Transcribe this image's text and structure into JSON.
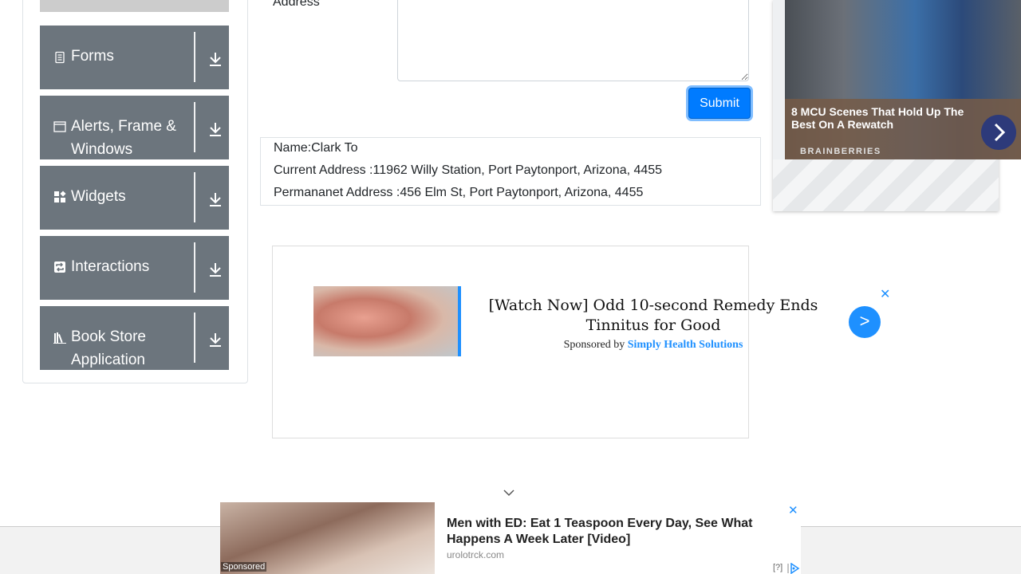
{
  "sidebar": {
    "groups": [
      {
        "label": "Forms",
        "icon": "form-icon"
      },
      {
        "label": "Alerts, Frame & Windows",
        "icon": "window-icon"
      },
      {
        "label": "Widgets",
        "icon": "widgets-icon"
      },
      {
        "label": "Interactions",
        "icon": "interactions-icon"
      },
      {
        "label": "Book Store Application",
        "icon": "books-icon"
      }
    ]
  },
  "form": {
    "address_label": "Address",
    "submit_label": "Submit"
  },
  "output": {
    "name": "Name:Clark To",
    "current_address": "Current Address :11962 Willy Station, Port Paytonport, Arizona, 4455",
    "permanent_address": "Permananet Address :456 Elm St, Port Paytonport, Arizona, 4455"
  },
  "right_ad": {
    "title": "8 MCU Scenes That Hold Up The Best On A Rewatch",
    "brand": "BRAINBERRIES"
  },
  "mid_ad": {
    "title": "[Watch Now] Odd 10-second Remedy Ends Tinnitus for Good",
    "sponsored_prefix": "Sponsored by",
    "sponsor": "Simply Health Solutions",
    "go_label": ">",
    "close_label": "✕"
  },
  "bottom_ad": {
    "title": "Men with ED: Eat 1 Teaspoon Every Day, See What Happens A Week Later [Video]",
    "url": "urolotrck.com",
    "sponsored": "Sponsored",
    "close_label": "✕",
    "help_label": "[?]"
  },
  "colors": {
    "accent": "#007bff",
    "group_bg": "#6c757d",
    "ad_blue": "#1e90ff"
  }
}
